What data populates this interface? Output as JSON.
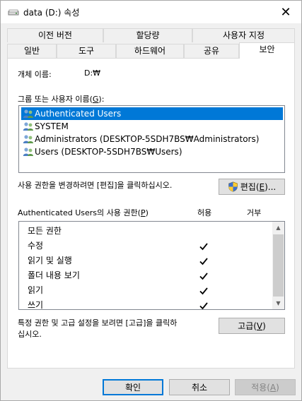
{
  "window": {
    "title": "data (D:) 속성",
    "close": "✕"
  },
  "tabs_top": [
    "이전 버전",
    "할당량",
    "사용자 지정"
  ],
  "tabs_bottom": [
    "일반",
    "도구",
    "하드웨어",
    "공유",
    "보안"
  ],
  "object_name_label": "개체 이름:",
  "object_name_value": "D:₩",
  "group_label": "그룹 또는 사용자 이름(",
  "group_label_key": "G",
  "group_label_end": "):",
  "users": [
    "Authenticated Users",
    "SYSTEM",
    "Administrators (DESKTOP-5SDH7BS₩Administrators)",
    "Users (DESKTOP-5SDH7BS₩Users)"
  ],
  "edit_hint": "사용 권한을 변경하려면 [편집]을 클릭하십시오.",
  "edit_button": {
    "text": "편집(",
    "key": "E",
    "end": ")..."
  },
  "perm_label": "Authenticated Users의 사용 권한(",
  "perm_label_key": "P",
  "perm_label_end": ")",
  "allow_label": "허용",
  "deny_label": "거부",
  "permissions": [
    {
      "name": "모든 권한",
      "allow": false
    },
    {
      "name": "수정",
      "allow": true
    },
    {
      "name": "읽기 및 실행",
      "allow": true
    },
    {
      "name": "폴더 내용 보기",
      "allow": true
    },
    {
      "name": "읽기",
      "allow": true
    },
    {
      "name": "쓰기",
      "allow": true
    }
  ],
  "advanced_hint_1": "특정 권한 및 고급 설정을 보려면 [고급]을 클릭하",
  "advanced_hint_2": "십시오.",
  "advanced_button": {
    "text": "고급(",
    "key": "V",
    "end": ")"
  },
  "footer": {
    "ok": "확인",
    "cancel": "취소",
    "apply_text": "적용(",
    "apply_key": "A",
    "apply_end": ")"
  }
}
